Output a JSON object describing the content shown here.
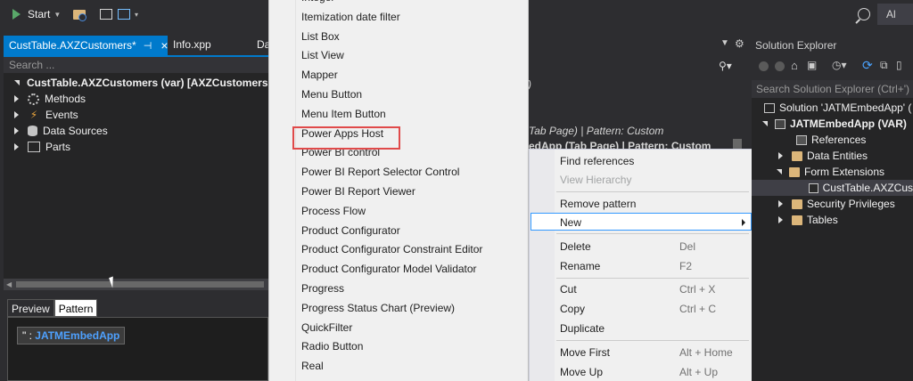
{
  "toolbar": {
    "start_label": "Start",
    "right_button_label": "Al"
  },
  "tabs": {
    "active_label": "CustTable.AXZCustomers*",
    "tab2_label": "Info.xpp",
    "tab3_label": "Da"
  },
  "designer": {
    "search_placeholder": "Search ...",
    "root_label": "CustTable.AXZCustomers (var) [AXZCustomers",
    "items": [
      {
        "label": "Methods"
      },
      {
        "label": "Events"
      },
      {
        "label": "Data Sources"
      },
      {
        "label": "Parts"
      }
    ]
  },
  "bottom": {
    "preview_tab": "Preview",
    "pattern_tab": "Pattern",
    "pattern_prefix": "\" :",
    "pattern_value": "JATMEmbedApp"
  },
  "background_text": {
    "line1": "Tab Page) | Pattern: Custom",
    "line2": "edApp (Tab Page) | Pattern: Custom",
    "paren": ")"
  },
  "dropdown": {
    "items": [
      "Integer",
      "Itemization date filter",
      "List Box",
      "List View",
      "Mapper",
      "Menu Button",
      "Menu Item Button",
      "Power Apps Host",
      "Power BI control",
      "Power BI Report Selector Control",
      "Power BI Report Viewer",
      "Process Flow",
      "Product Configurator",
      "Product Configurator Constraint Editor",
      "Product Configurator Model Validator",
      "Progress",
      "Progress Status Chart (Preview)",
      "QuickFilter",
      "Radio Button",
      "Real"
    ],
    "highlighted_item": "Power Apps Host",
    "highlight_color": "#e04a4a"
  },
  "context_menu": {
    "find_references": "Find references",
    "view_hierarchy": "View Hierarchy",
    "remove_pattern": "Remove pattern",
    "new": "New",
    "delete": "Delete",
    "delete_shortcut": "Del",
    "rename": "Rename",
    "rename_shortcut": "F2",
    "cut": "Cut",
    "cut_shortcut": "Ctrl + X",
    "copy": "Copy",
    "copy_shortcut": "Ctrl + C",
    "duplicate": "Duplicate",
    "move_first": "Move First",
    "move_first_shortcut": "Alt + Home",
    "move_up": "Move Up",
    "move_up_shortcut": "Alt + Up"
  },
  "solution_explorer": {
    "title": "Solution Explorer",
    "search_placeholder": "Search Solution Explorer (Ctrl+')",
    "items": [
      {
        "label": "Solution 'JATMEmbedApp' ("
      },
      {
        "label": "JATMEmbedApp (VAR)"
      },
      {
        "label": "References"
      },
      {
        "label": "Data Entities"
      },
      {
        "label": "Form Extensions"
      },
      {
        "label": "CustTable.AXZCus"
      },
      {
        "label": "Security Privileges"
      },
      {
        "label": "Tables"
      }
    ]
  },
  "colors": {
    "accent": "#007acc",
    "background": "#2d2d30",
    "panel": "#252526"
  }
}
